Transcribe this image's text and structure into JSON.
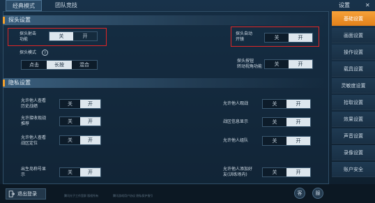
{
  "top_tabs": [
    "经典模式",
    "团队竞技"
  ],
  "settings_header": {
    "title": "设置",
    "close": "✕"
  },
  "sections": {
    "peek": "探头设置",
    "privacy": "隐私设置"
  },
  "peek": {
    "fire_label_1": "探头射击",
    "fire_label_2": "功能",
    "auto_label_1": "探头自动",
    "auto_label_2": "开镜",
    "mode_label": "探头模式",
    "mode_help": "?",
    "mode_options": [
      "点击",
      "长按",
      "混合"
    ],
    "btn_label_1": "探头按钮",
    "btn_label_2": "转动视角功能"
  },
  "toggle": {
    "off": "关",
    "on": "开"
  },
  "privacy": {
    "rows": [
      {
        "l1": "允许他人查看",
        "l2": "历史战绩"
      },
      {
        "l1": "允许接收现战",
        "l2": "推荐"
      },
      {
        "l1": "允许他人查看",
        "l2": "战区定位"
      },
      {
        "l1": "出生岛称号显",
        "l2": "示"
      }
    ],
    "right_rows": [
      {
        "l1": "允许他人观战",
        "l2": ""
      },
      {
        "l1": "战区信息显示",
        "l2": ""
      },
      {
        "l1": "允许他人组队",
        "l2": "邀请"
      },
      {
        "l1": "允许他人添加好",
        "l2": "友(训练场内)"
      }
    ]
  },
  "sidebar": {
    "items": [
      "基础设置",
      "画面设置",
      "操作设置",
      "载具设置",
      "灵敏度设置",
      "拾取设置",
      "效果设置",
      "声音设置",
      "录像设置",
      "账户安全"
    ],
    "active_index": 0
  },
  "bottom": {
    "logout": "退出登录",
    "small_text_1": "腾讯光子工作室群 版权所有",
    "small_text_2": "腾讯游戏用户协议 隐私保护指引",
    "icon1": "客",
    "icon2": "服"
  }
}
